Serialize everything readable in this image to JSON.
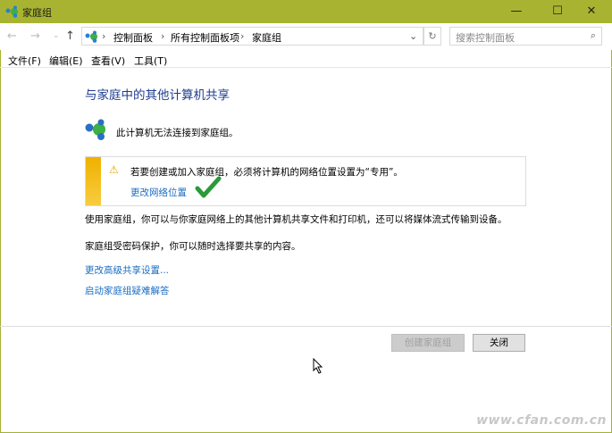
{
  "window": {
    "title": "家庭组",
    "minimize": "—",
    "maximize": "☐",
    "close": "✕"
  },
  "nav": {
    "back": "←",
    "forward": "→",
    "recent": "⌄",
    "up": "↑",
    "breadcrumb": [
      "控制面板",
      "所有控制面板项",
      "家庭组"
    ],
    "separator": "›",
    "dropdown": "⌄",
    "refresh": "↻",
    "search_placeholder": "搜索控制面板",
    "search_icon": "⌕"
  },
  "menu": [
    "文件(F)",
    "编辑(E)",
    "查看(V)",
    "工具(T)"
  ],
  "main": {
    "heading": "与家庭中的其他计算机共享",
    "status": "此计算机无法连接到家庭组。",
    "warning": {
      "icon": "⚠",
      "text": "若要创建或加入家庭组，必须将计算机的网络位置设置为“专用”。",
      "link": "更改网络位置"
    },
    "para1": "使用家庭组，你可以与你家庭网络上的其他计算机共享文件和打印机，还可以将媒体流式传输到设备。",
    "para2": "家庭组受密码保护，你可以随时选择要共享的内容。",
    "link1": "更改高级共享设置...",
    "link2": "启动家庭组疑难解答"
  },
  "buttons": {
    "create": "创建家庭组",
    "close": "关闭"
  },
  "watermark": "www.cfan.com.cn"
}
